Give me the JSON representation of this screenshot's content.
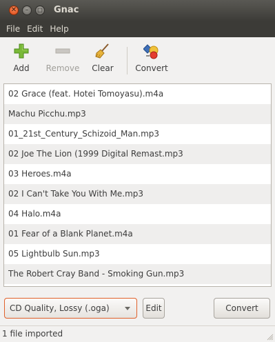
{
  "window": {
    "title": "Gnac"
  },
  "menubar": {
    "items": [
      "File",
      "Edit",
      "Help"
    ]
  },
  "toolbar": {
    "add_label": "Add",
    "remove_label": "Remove",
    "clear_label": "Clear",
    "convert_label": "Convert"
  },
  "files": [
    "02 Grace (feat. Hotei Tomoyasu).m4a",
    "Machu Picchu.mp3",
    "01_21st_Century_Schizoid_Man.mp3",
    "02 Joe The Lion (1999 Digital Remast.mp3",
    "03 Heroes.m4a",
    "02 I Can't Take You With Me.mp3",
    "04 Halo.m4a",
    "01 Fear of a Blank Planet.m4a",
    "05 Lightbulb Sun.mp3",
    "The Robert Cray Band - Smoking Gun.mp3"
  ],
  "profile": {
    "selected": "CD Quality, Lossy (.oga)"
  },
  "buttons": {
    "edit_label": "Edit",
    "convert_label": "Convert"
  },
  "status": {
    "text": "1 file imported"
  },
  "colors": {
    "accent": "#dd4814",
    "titlebar": "#3c3b37"
  }
}
